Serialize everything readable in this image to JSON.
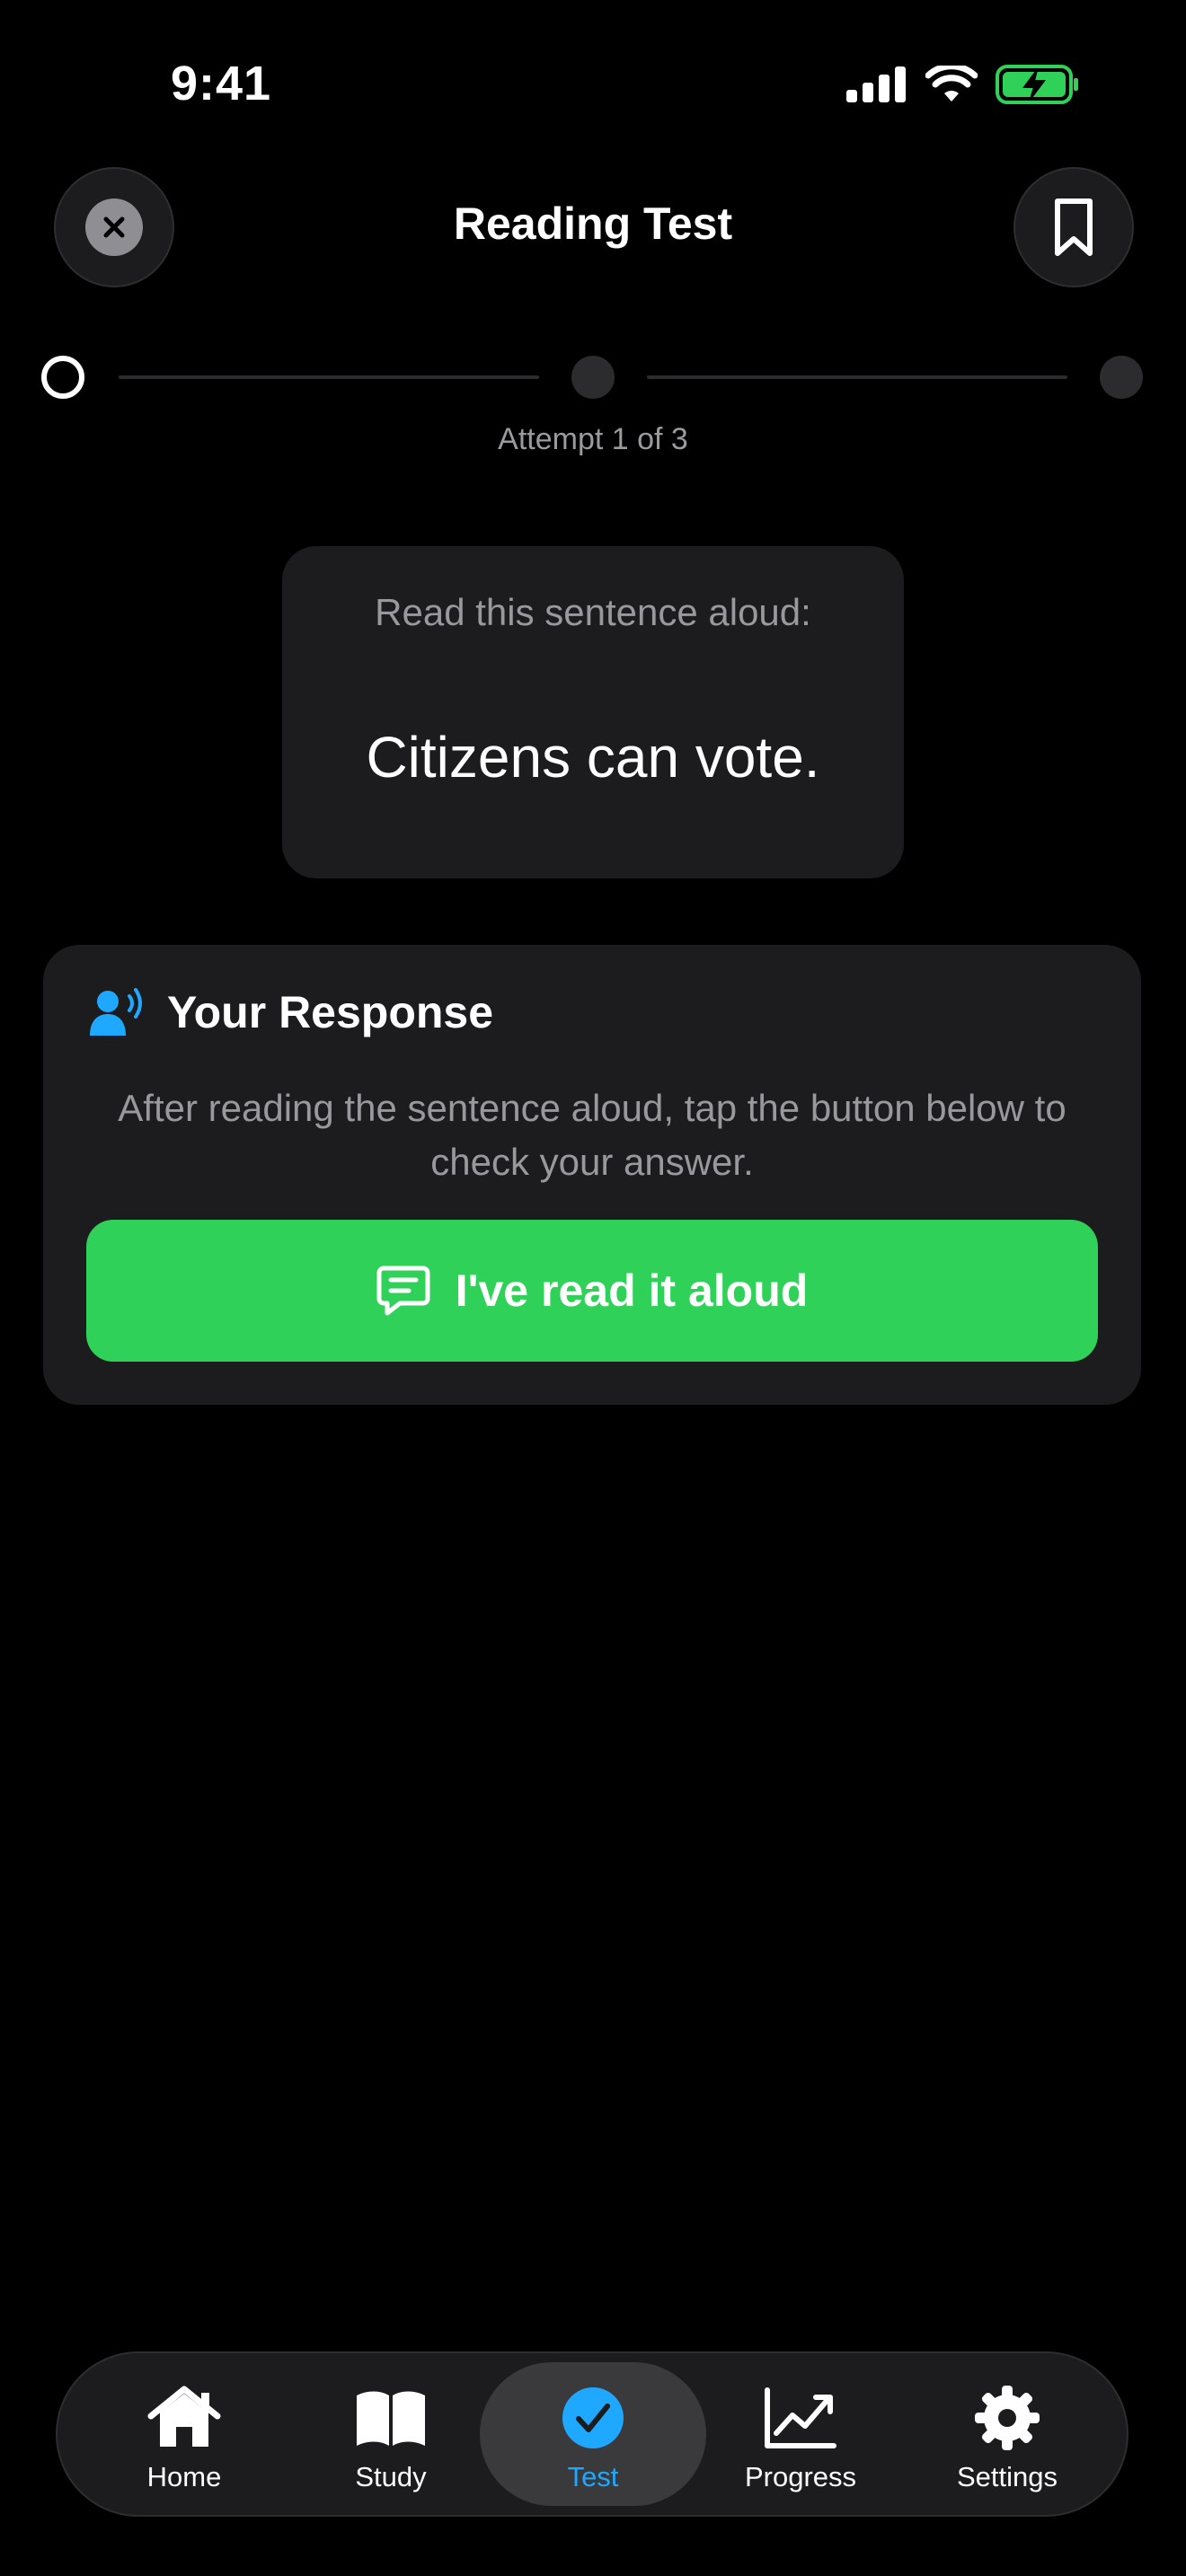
{
  "status_bar": {
    "time": "9:41"
  },
  "header": {
    "title": "Reading Test"
  },
  "progress": {
    "attempt_text": "Attempt 1 of 3",
    "current_step": 1,
    "total_steps": 3
  },
  "prompt": {
    "instruction": "Read this sentence aloud:",
    "sentence": "Citizens can vote."
  },
  "response": {
    "title": "Your Response",
    "description": "After reading the sentence aloud, tap the button below to check your answer.",
    "button_label": "I've read it aloud"
  },
  "tabbar": {
    "items": [
      {
        "label": "Home",
        "icon": "house-icon"
      },
      {
        "label": "Study",
        "icon": "book-icon"
      },
      {
        "label": "Test",
        "icon": "checkmark-circle-icon",
        "active": true
      },
      {
        "label": "Progress",
        "icon": "chart-icon"
      },
      {
        "label": "Settings",
        "icon": "gear-icon"
      }
    ]
  },
  "colors": {
    "background": "#000000",
    "card": "#1c1c1e",
    "accent_green": "#30d158",
    "accent_blue": "#1fa8ff",
    "secondary_text": "#98989d"
  }
}
